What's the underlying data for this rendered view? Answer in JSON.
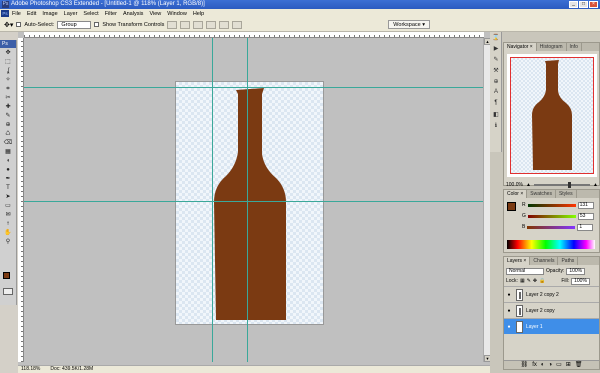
{
  "window": {
    "title": "Adobe Photoshop CS3 Extended - [Untitled-1 @ 118% (Layer 1, RGB/8)]",
    "logo": "Ps",
    "controls": [
      "_",
      "□",
      "×"
    ]
  },
  "menubar": {
    "items": [
      "File",
      "Edit",
      "Image",
      "Layer",
      "Select",
      "Filter",
      "Analysis",
      "View",
      "Window",
      "Help"
    ]
  },
  "options_bar": {
    "auto_select_label": "Auto-Select:",
    "auto_select_value": "Group",
    "transform_label": "Show Transform Controls",
    "workspace_label": "Workspace ▾"
  },
  "toolbox": {
    "header": "Ps",
    "tools": [
      "move-icon",
      "marquee-icon",
      "lasso-icon",
      "magic-wand-icon",
      "crop-icon",
      "slice-icon",
      "healing-icon",
      "brush-icon",
      "stamp-icon",
      "history-brush-icon",
      "eraser-icon",
      "gradient-icon",
      "blur-icon",
      "dodge-icon",
      "pen-icon",
      "type-icon",
      "path-select-icon",
      "shape-icon",
      "notes-icon",
      "eyedropper-icon",
      "hand-icon",
      "zoom-icon"
    ],
    "tool_glyphs": [
      "✥",
      "⬚",
      "ʆ",
      "✧",
      "⌗",
      "✂",
      "✚",
      "✎",
      "⊕",
      "♺",
      "⌫",
      "▦",
      "◖",
      "●",
      "✒",
      "T",
      "➤",
      "▭",
      "✉",
      "⟊",
      "✋",
      "⚲"
    ],
    "foreground_color": "#7b3a12",
    "background_color": "#000000"
  },
  "canvas": {
    "object": "brown bottle",
    "fill_color": "#7b3a12"
  },
  "status_bar": {
    "zoom": "118.18%",
    "doc_info": "Doc: 439.5K/1.28M"
  },
  "navigator": {
    "tabs": [
      "Navigator ×",
      "Histogram",
      "Info"
    ],
    "zoom_value": "100.0%"
  },
  "color_panel": {
    "tabs": [
      "Color ×",
      "Swatches",
      "Styles"
    ],
    "channels": [
      {
        "label": "R",
        "value": "131",
        "fraction": 0.51
      },
      {
        "label": "G",
        "value": "53",
        "fraction": 0.21
      },
      {
        "label": "B",
        "value": "1",
        "fraction": 0.0
      }
    ]
  },
  "layers_panel": {
    "tabs": [
      "Layers ×",
      "Channels",
      "Paths"
    ],
    "blend_mode": "Normal",
    "opacity_label": "Opacity:",
    "opacity_value": "100%",
    "lock_label": "Lock:",
    "fill_label": "Fill:",
    "fill_value": "100%",
    "layers": [
      {
        "name": "Layer 2 copy 2",
        "selected": false
      },
      {
        "name": "Layer 2 copy",
        "selected": false
      },
      {
        "name": "Layer 1",
        "selected": true
      }
    ],
    "footer_icons": [
      "⛓",
      "fx",
      "◐",
      "◑",
      "▭",
      "⊞",
      "🗑"
    ]
  }
}
